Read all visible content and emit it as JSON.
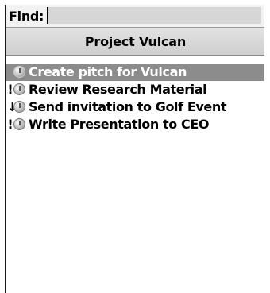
{
  "find": {
    "label": "Find:",
    "value": ""
  },
  "title": "Project Vulcan",
  "tasks": [
    {
      "priority": "",
      "label": "Create pitch for Vulcan",
      "icon": "clock-icon",
      "selected": true
    },
    {
      "priority": "!",
      "label": "Review Research Material",
      "icon": "clock-icon",
      "selected": false
    },
    {
      "priority": "↓",
      "label": "Send invitation to Golf Event",
      "icon": "clock-icon",
      "selected": false
    },
    {
      "priority": "!",
      "label": "Write Presentation to CEO",
      "icon": "clock-icon",
      "selected": false
    }
  ],
  "colors": {
    "selection": "#8c8c8c",
    "title_bar": "#d6d6d6",
    "find_input": "#d6d6d6"
  }
}
